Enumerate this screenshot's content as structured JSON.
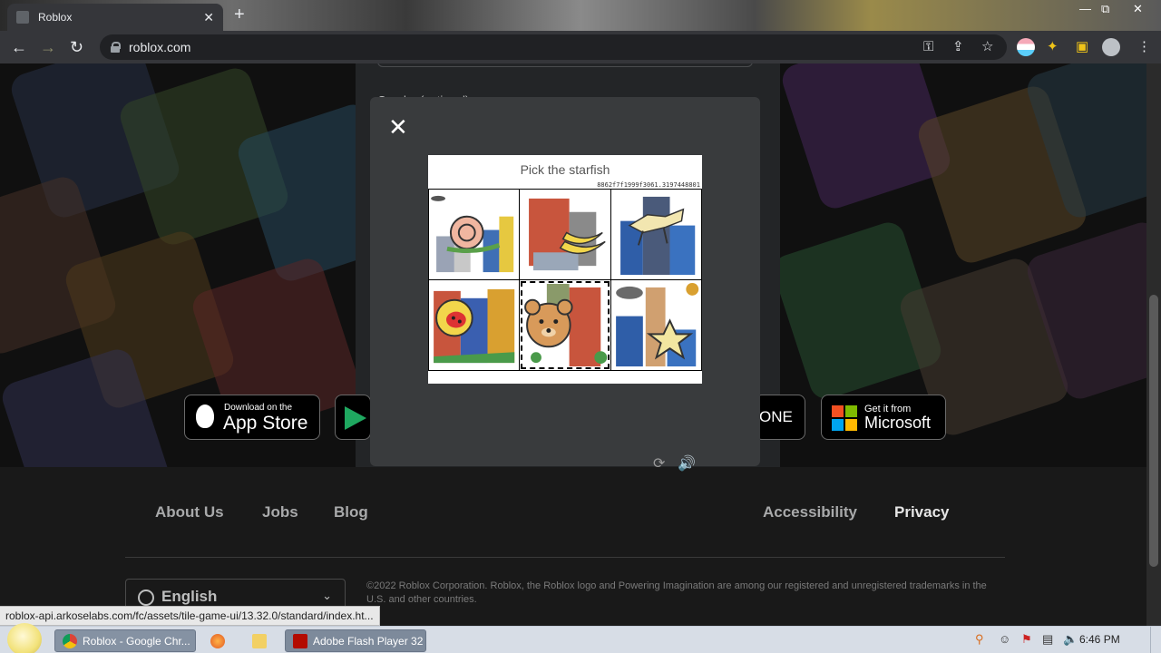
{
  "browser": {
    "tab_title": "Roblox",
    "tab_close": "✕",
    "new_tab": "+",
    "url": "roblox.com",
    "win_min": "—",
    "win_max": "⧉",
    "win_close": "✕",
    "icons": [
      "back-icon",
      "forward-icon",
      "reload-icon",
      "key-icon",
      "share-icon",
      "star-icon",
      "profile-icon",
      "extensions-icon",
      "sidepanel-icon",
      "menu-icon"
    ]
  },
  "signup": {
    "gender_label": "Gender (optional)"
  },
  "app_badges": {
    "appstore_small": "Download on the",
    "appstore_big": "App Store",
    "xbox_text": "ONE",
    "microsoft_small": "Get it from",
    "microsoft_big": "Microsoft"
  },
  "footer": {
    "links": [
      "About Us",
      "Jobs",
      "Blog",
      "Accessibility",
      "Privacy"
    ],
    "language": "English",
    "copyright": "©2022 Roblox Corporation. Roblox, the Roblox logo and Powering Imagination are among our registered and unregistered trademarks in the U.S. and other countries."
  },
  "captcha": {
    "close_glyph": "✕",
    "prompt": "Pick the starfish",
    "id": "8862f7f1999f3061.3197448801",
    "tiles": [
      "snail-in-city",
      "bananas-in-city",
      "horse-in-city",
      "ladybug-in-city",
      "bear-in-city",
      "starfish-in-city"
    ],
    "selected_tile": 4,
    "refresh_glyph": "⟳",
    "audio_glyph": "🔊"
  },
  "status_url": "roblox-api.arkoselabs.com/fc/assets/tile-game-ui/13.32.0/standard/index.ht...",
  "taskbar": {
    "chrome_label": "Roblox - Google Chr...",
    "flash_label": "Adobe Flash Player 32",
    "clock": "6:46 PM"
  },
  "colors": {
    "chrome_toolbar": "#35363a",
    "page_bg": "#191919",
    "modal_bg": "#393b3d",
    "taskbar_bg": "#d7dde6"
  }
}
